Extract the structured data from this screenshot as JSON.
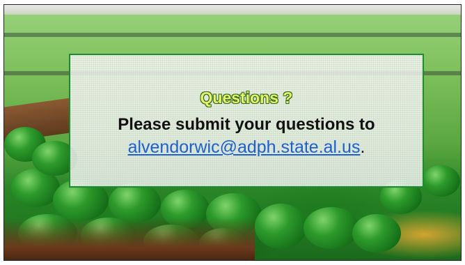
{
  "slide": {
    "title": "Questions ?",
    "body": "Please submit your questions to",
    "email": "alvendorwic@adph.state.al.us",
    "email_suffix": "."
  }
}
